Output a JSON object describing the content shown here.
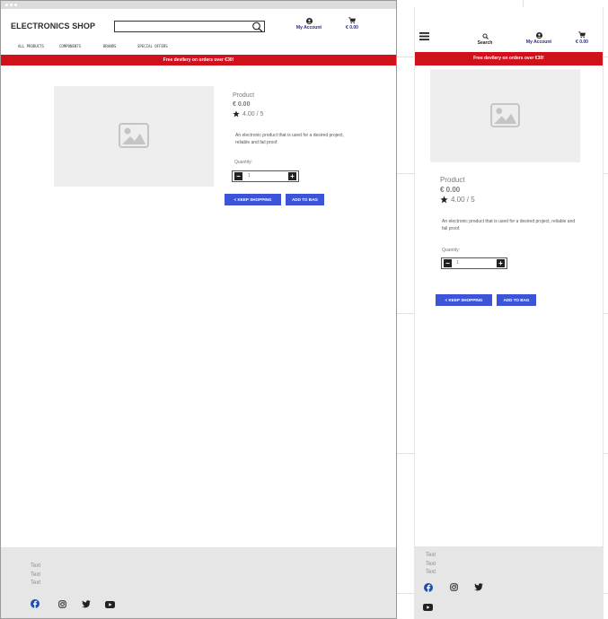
{
  "shop": {
    "logo": "ELECTRONICS SHOP",
    "account_label": "My Account",
    "cart_total": "€ 0.00",
    "search_label": "Search",
    "nav": [
      "ALL PRODUCTS",
      "COMPONENTS",
      "BRANDS",
      "SPECIAL OFFERS"
    ],
    "banner": "Free devilery on orders over €30!"
  },
  "product": {
    "name": "Product",
    "price": "€ 0.00",
    "rating": "4.00 / 5",
    "description": "An electronic product that is used for a desired project, reliable and fail proof.",
    "quantity_label": "Quantity:",
    "quantity_value": "1",
    "keep_shopping": "< KEEP SHOPPING",
    "add_to_bag": "ADD TO BAG"
  },
  "footer": {
    "lines": [
      "Text",
      "Text",
      "Text"
    ],
    "social_icons": [
      "facebook-icon",
      "instagram-icon",
      "twitter-icon",
      "youtube-icon"
    ]
  },
  "colors": {
    "banner": "#d0101a",
    "button": "#3c55d8",
    "footer_bg": "#e6e6e6",
    "facebook": "#1b4fb0"
  }
}
